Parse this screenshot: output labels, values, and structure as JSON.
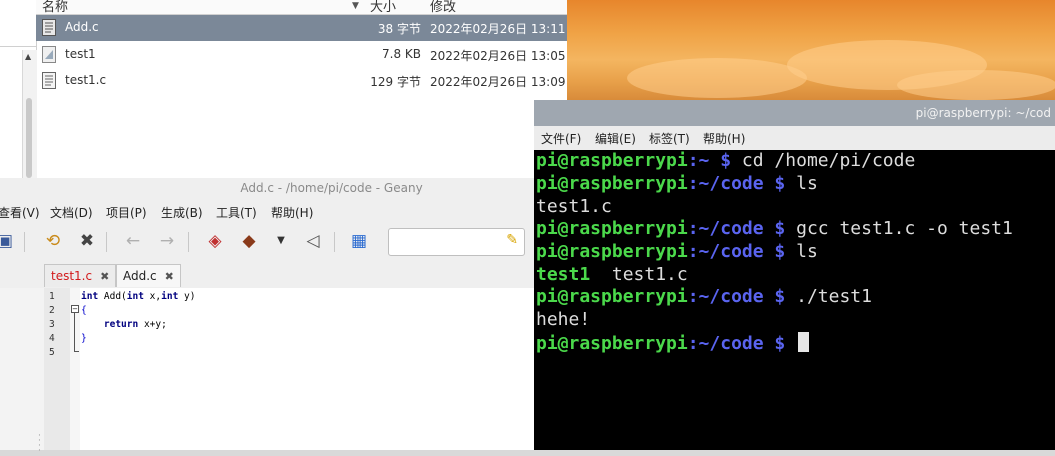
{
  "file_manager": {
    "columns": {
      "name": "名称",
      "size": "大小",
      "modified": "修改"
    },
    "files": [
      {
        "name": "Add.c",
        "size": "38 字节",
        "modified": "2022年02月26日 13:11",
        "selected": true,
        "icon": "text-file-icon"
      },
      {
        "name": "test1",
        "size": "7.8 KB",
        "modified": "2022年02月26日 13:05",
        "selected": false,
        "icon": "executable-file-icon"
      },
      {
        "name": "test1.c",
        "size": "129 字节",
        "modified": "2022年02月26日 13:09",
        "selected": false,
        "icon": "text-file-icon"
      }
    ],
    "selection_color": "#7b8898"
  },
  "geany": {
    "title": "Add.c - /home/pi/code - Geany",
    "menu": [
      "查看(V)",
      "文档(D)",
      "项目(P)",
      "生成(B)",
      "工具(T)",
      "帮助(H)"
    ],
    "toolbar_icons": [
      "save-all-icon",
      "revert-icon",
      "close-icon",
      "back-icon",
      "forward-icon",
      "compile-icon",
      "build-icon",
      "dropdown-icon",
      "run-icon",
      "color-chooser-icon"
    ],
    "search_placeholder": "",
    "tabs": [
      {
        "label": "test1.c",
        "close": "✖",
        "modified": true
      },
      {
        "label": "Add.c",
        "close": "✖",
        "modified": false
      }
    ],
    "line_numbers": [
      "1",
      "2",
      "3",
      "4",
      "5"
    ],
    "code": {
      "l1_kw1": "int",
      "l1_fn": " Add(",
      "l1_kw2": "int",
      "l1_p1": " x,",
      "l1_kw3": "int",
      "l1_p2": " y)",
      "l2": "{",
      "l3_indent": "    ",
      "l3_kw": "return",
      "l3_rest": " x+y;",
      "l4": "}"
    }
  },
  "terminal": {
    "title": "pi@raspberrypi: ~/cod",
    "menu": [
      "文件(F)",
      "编辑(E)",
      "标签(T)",
      "帮助(H)"
    ],
    "lines": [
      {
        "user": "pi@raspberrypi",
        "path": ":~ ",
        "sign": "$ ",
        "cmd": "cd /home/pi/code"
      },
      {
        "user": "pi@raspberrypi",
        "path": ":~/code ",
        "sign": "$ ",
        "cmd": "ls"
      },
      {
        "output": "test1.c"
      },
      {
        "user": "pi@raspberrypi",
        "path": ":~/code ",
        "sign": "$ ",
        "cmd": "gcc test1.c -o test1"
      },
      {
        "user": "pi@raspberrypi",
        "path": ":~/code ",
        "sign": "$ ",
        "cmd": "ls"
      },
      {
        "exec": "test1",
        "output": "  test1.c"
      },
      {
        "user": "pi@raspberrypi",
        "path": ":~/code ",
        "sign": "$ ",
        "cmd": "./test1"
      },
      {
        "output": "hehe!"
      },
      {
        "user": "pi@raspberrypi",
        "path": ":~/code ",
        "sign": "$ ",
        "cmd": ""
      }
    ],
    "colors": {
      "prompt_user": "#4bd94b",
      "prompt_path": "#5a64f0",
      "background": "#000000"
    }
  }
}
